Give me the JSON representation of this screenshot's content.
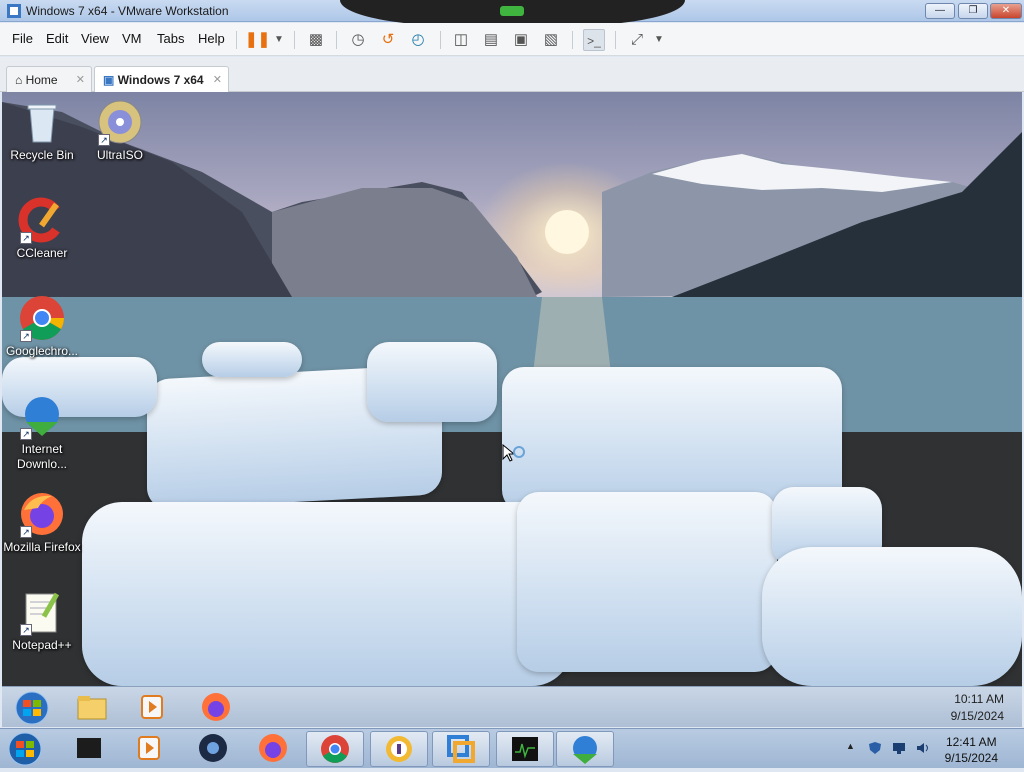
{
  "window": {
    "title": "Windows 7 x64 - VMware Workstation",
    "buttons": [
      "minimize",
      "restore",
      "close"
    ]
  },
  "menu": [
    "File",
    "Edit",
    "View",
    "VM",
    "Tabs",
    "Help"
  ],
  "toolbar_icons": [
    "pause-icon",
    "dropdown-arrow-icon",
    "send-ctrl-alt-del-icon",
    "snapshot-icon",
    "revert-snapshot-icon",
    "snapshot-manager-icon",
    "show-library-icon",
    "thumbnail-icon",
    "fullscreen-icon",
    "unity-icon",
    "console-view-icon",
    "stretch-guest-icon",
    "dropdown-arrow-icon"
  ],
  "tabs": [
    {
      "label": "Home",
      "icon": "home-icon"
    },
    {
      "label": "Windows 7 x64",
      "icon": "vm-icon"
    }
  ],
  "desktop_icons": [
    {
      "label": "Recycle Bin",
      "icon": "recycle-bin-icon"
    },
    {
      "label": "UltraISO",
      "icon": "ultraiso-icon"
    },
    {
      "label": "CCleaner",
      "icon": "ccleaner-icon"
    },
    {
      "label": "Googlechro...",
      "icon": "chrome-icon"
    },
    {
      "label": "Internet Downlo...",
      "icon": "idm-icon"
    },
    {
      "label": "Mozilla Firefox",
      "icon": "firefox-icon"
    },
    {
      "label": "Notepad++",
      "icon": "notepadpp-icon"
    }
  ],
  "guest_taskbar": {
    "items": [
      "start-orb-icon",
      "explorer-icon",
      "media-player-icon",
      "firefox-icon"
    ],
    "time": "10:11 AM",
    "date": "9/15/2024"
  },
  "host_taskbar": {
    "items": [
      "start-orb-icon",
      "media-icon",
      "media-player-icon",
      "app-icon",
      "firefox-icon",
      "chrome-icon",
      "app-icon",
      "vmware-icon",
      "monitor-icon",
      "idm-icon"
    ],
    "time": "12:41 AM",
    "date": "9/15/2024",
    "tray_icons": [
      "show-hidden-icon",
      "shield-icon",
      "network-icon",
      "volume-icon"
    ]
  },
  "colors": {
    "accent": "#3a78c4",
    "pause": "#e8700f",
    "close": "#c9452c"
  }
}
